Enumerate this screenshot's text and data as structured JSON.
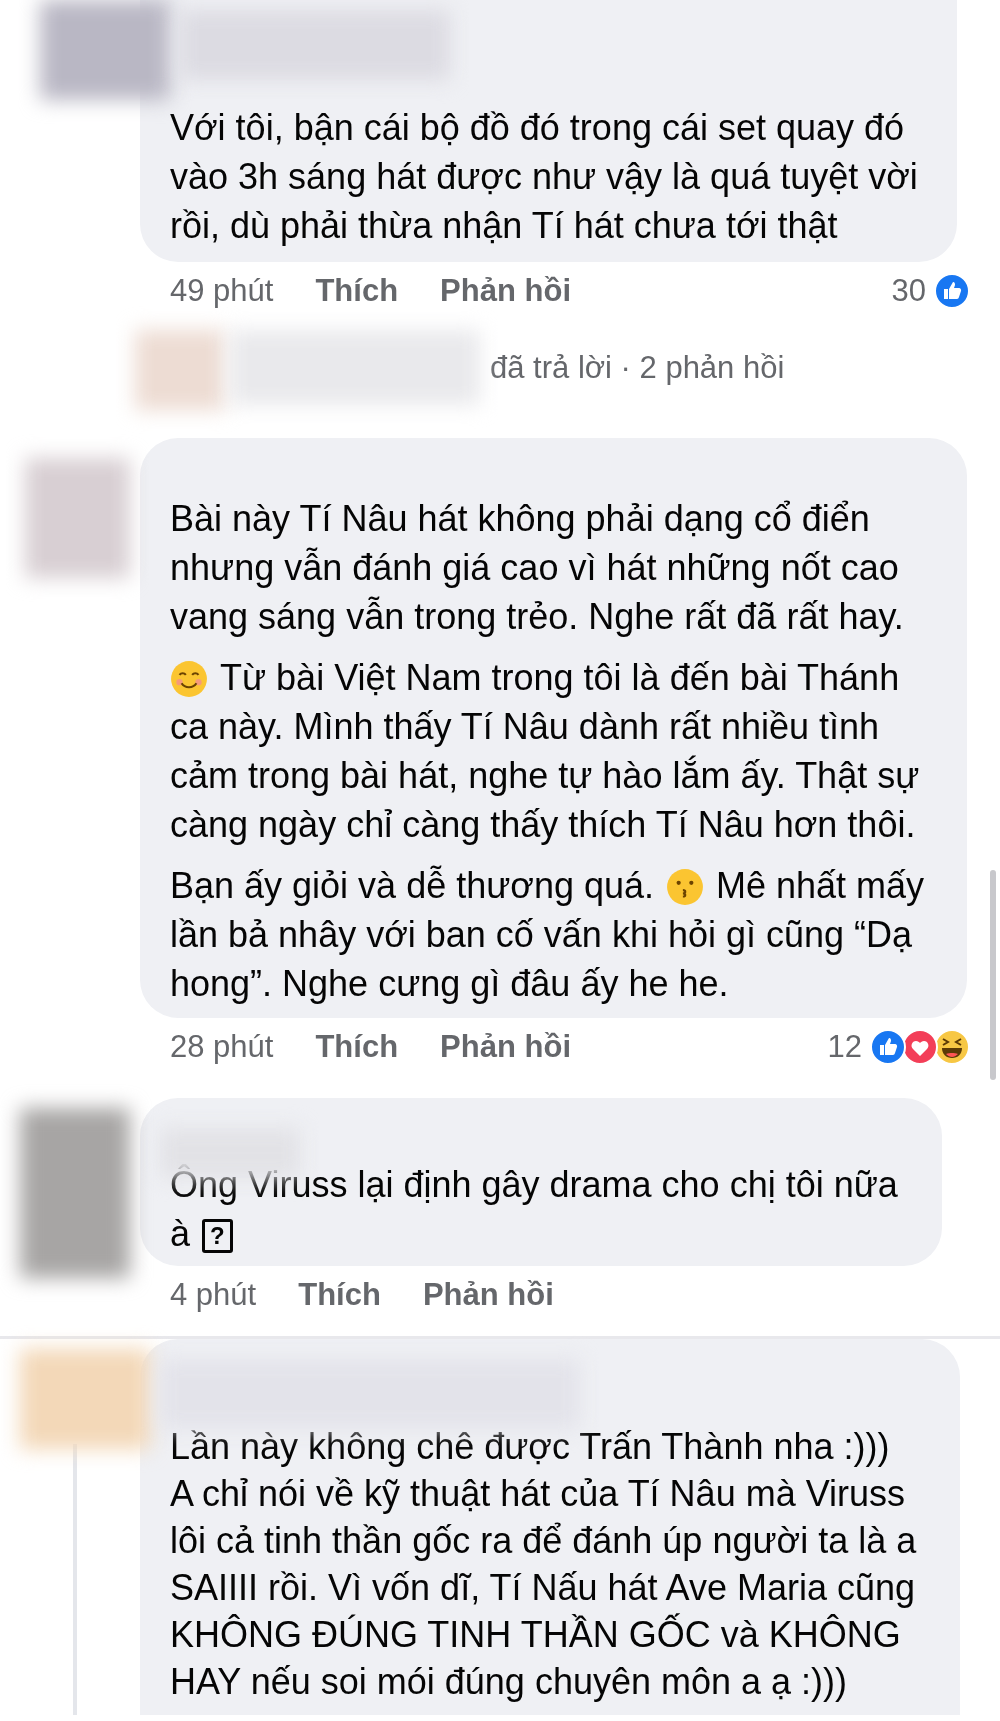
{
  "comments": [
    {
      "thread_line": false,
      "paragraphs": [
        [
          {
            "kind": "text",
            "lines": [
              "Với tôi, bận cái bộ đồ đó trong cái set quay đó",
              "vào 3h sáng hát được như vậy là quá tuyệt vời",
              "rồi, dù phải thừa nhận Tí hát chưa tới thật"
            ]
          }
        ]
      ],
      "actions": {
        "time": "49 phút",
        "like": "Thích",
        "reply": "Phản hồi",
        "count": "30",
        "reactions": [
          {
            "kind": "like"
          }
        ]
      },
      "replies_summary": "đã trả lời · 2 phản hồi"
    },
    {
      "thread_line": false,
      "paragraphs": [
        [
          {
            "kind": "text",
            "lines": [
              "Bài này Tí Nâu hát không phải dạng cổ điển",
              "nhưng vẫn đánh giá cao vì hát những nốt cao",
              "vang sáng vẫn trong trẻo. Nghe rất đã rất hay."
            ]
          }
        ],
        [
          {
            "kind": "smile"
          },
          {
            "kind": "text",
            "lines": [
              "Từ bài Việt Nam trong tôi là đến bài Thánh",
              "ca này. Mình thấy Tí Nâu dành rất nhiều tình",
              "cảm trong bài hát, nghe tự hào lắm ấy. Thật sự",
              "càng ngày chỉ càng thấy thích Tí Nâu hơn thôi."
            ]
          }
        ],
        [
          {
            "kind": "text",
            "lines": [
              "Bạn ấy giỏi và dễ thương quá."
            ]
          },
          {
            "kind": "kiss"
          },
          {
            "kind": "text",
            "lines": [
              "Mê nhất mấy",
              "lần bả nhây với ban cố vấn khi hỏi gì cũng “Dạ",
              "hong”. Nghe cưng gì đâu ấy he he."
            ]
          }
        ]
      ],
      "actions": {
        "time": "28 phút",
        "like": "Thích",
        "reply": "Phản hồi",
        "count": "12",
        "reactions": [
          {
            "kind": "like"
          },
          {
            "kind": "love"
          },
          {
            "kind": "haha"
          }
        ]
      }
    },
    {
      "thread_line": false,
      "paragraphs": [
        [
          {
            "kind": "text",
            "lines": [
              "Ông Viruss lại định gây drama cho chị tôi nữa",
              "à"
            ]
          },
          {
            "kind": "missing",
            "text": "?"
          }
        ]
      ],
      "actions": {
        "time": "4 phút",
        "like": "Thích",
        "reply": "Phản hồi"
      }
    },
    {
      "thread_line": true,
      "paragraphs": [
        [
          {
            "kind": "text",
            "lines": [
              "Lần này không chê được Trấn Thành nha :)))",
              "A chỉ nói về kỹ thuật hát của Tí Nâu mà Viruss",
              "lôi cả tinh thần gốc ra để đánh úp người ta là a",
              "SAIIII rồi. Vì vốn dĩ, Tí Nấu hát Ave Maria cũng",
              "KHÔNG ĐÚNG TINH THẦN GỐC và KHÔNG",
              "HAY nếu soi mói đúng chuyên môn a ạ :)))"
            ]
          }
        ]
      ]
    }
  ]
}
